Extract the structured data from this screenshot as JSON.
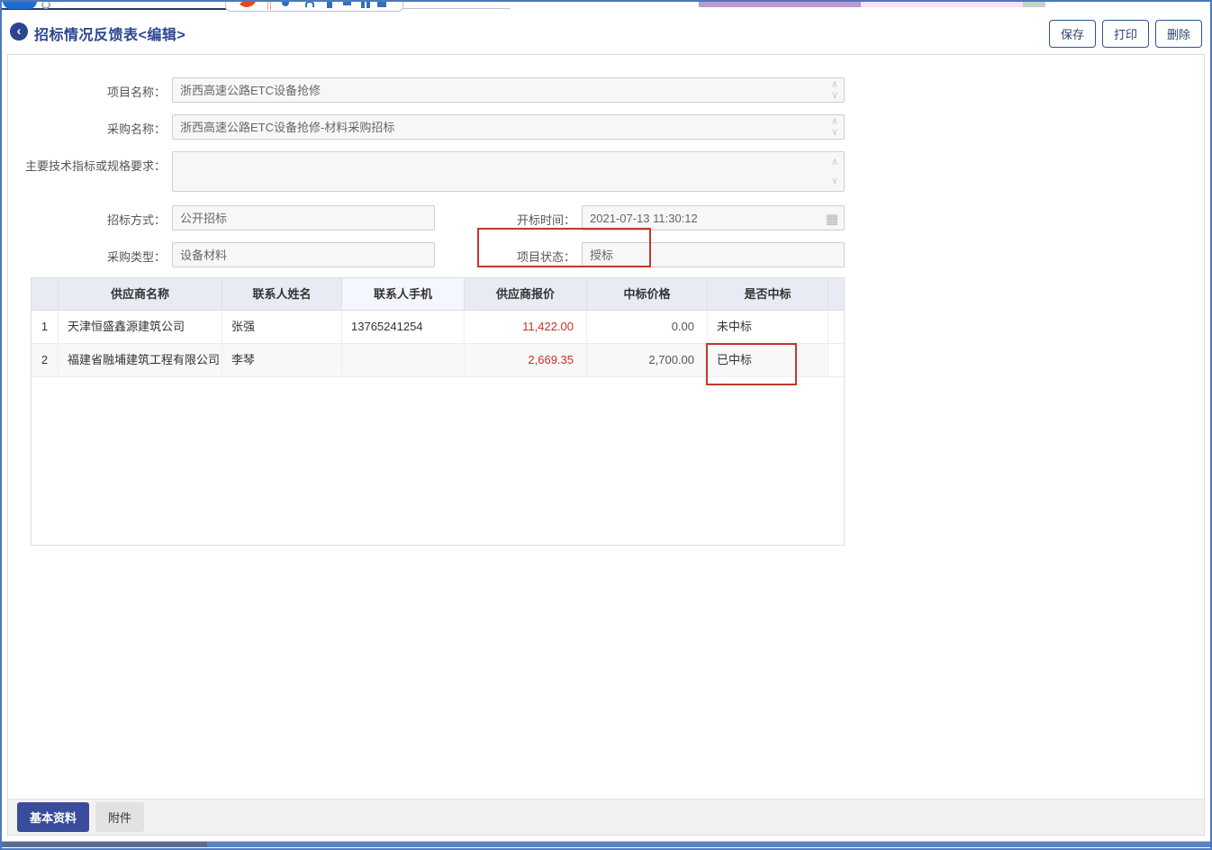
{
  "header": {
    "back_glyph": "‹",
    "title": "招标情况反馈表<编辑>",
    "buttons": [
      {
        "label": "保存"
      },
      {
        "label": "打印"
      },
      {
        "label": "删除"
      }
    ]
  },
  "form": {
    "project_name": {
      "label": "项目名称：",
      "value": "浙西高速公路ETC设备抢修"
    },
    "procurement_name": {
      "label": "采购名称：",
      "value": "浙西高速公路ETC设备抢修-材料采购招标"
    },
    "tech_spec": {
      "label": "主要技术指标或规格要求：",
      "value": ""
    },
    "bid_method": {
      "label": "招标方式：",
      "value": "公开招标"
    },
    "bid_open_time": {
      "label": "开标时间：",
      "value": "2021-07-13 11:30:12"
    },
    "procurement_type": {
      "label": "采购类型：",
      "value": "设备材料"
    },
    "project_status": {
      "label": "项目状态：",
      "value": "授标"
    }
  },
  "icons": {
    "calendar": "▦",
    "spinner_up": "∧",
    "spinner_down": "∨"
  },
  "table": {
    "headers": [
      "",
      "供应商名称",
      "联系人姓名",
      "联系人手机",
      "供应商报价",
      "中标价格",
      "是否中标"
    ],
    "rows": [
      {
        "no": "1",
        "supplier": "天津恒盛鑫源建筑公司",
        "contact": "张强",
        "phone": "13765241254",
        "quote": "11,422.00",
        "award_price": "0.00",
        "awarded": "未中标"
      },
      {
        "no": "2",
        "supplier": "福建省融埔建筑工程有限公司",
        "contact": "李琴",
        "phone": "",
        "quote": "2,669.35",
        "award_price": "2,700.00",
        "awarded": "已中标"
      }
    ]
  },
  "tabs": [
    {
      "label": "基本资料"
    },
    {
      "label": "附件"
    }
  ],
  "colors": {
    "accent_navy": "#2b4590",
    "price_red": "#c9302c",
    "annotation_red": "#c0392b",
    "active_tab": "#3a4d9c",
    "table_header_bg": "#e8ebf4"
  }
}
